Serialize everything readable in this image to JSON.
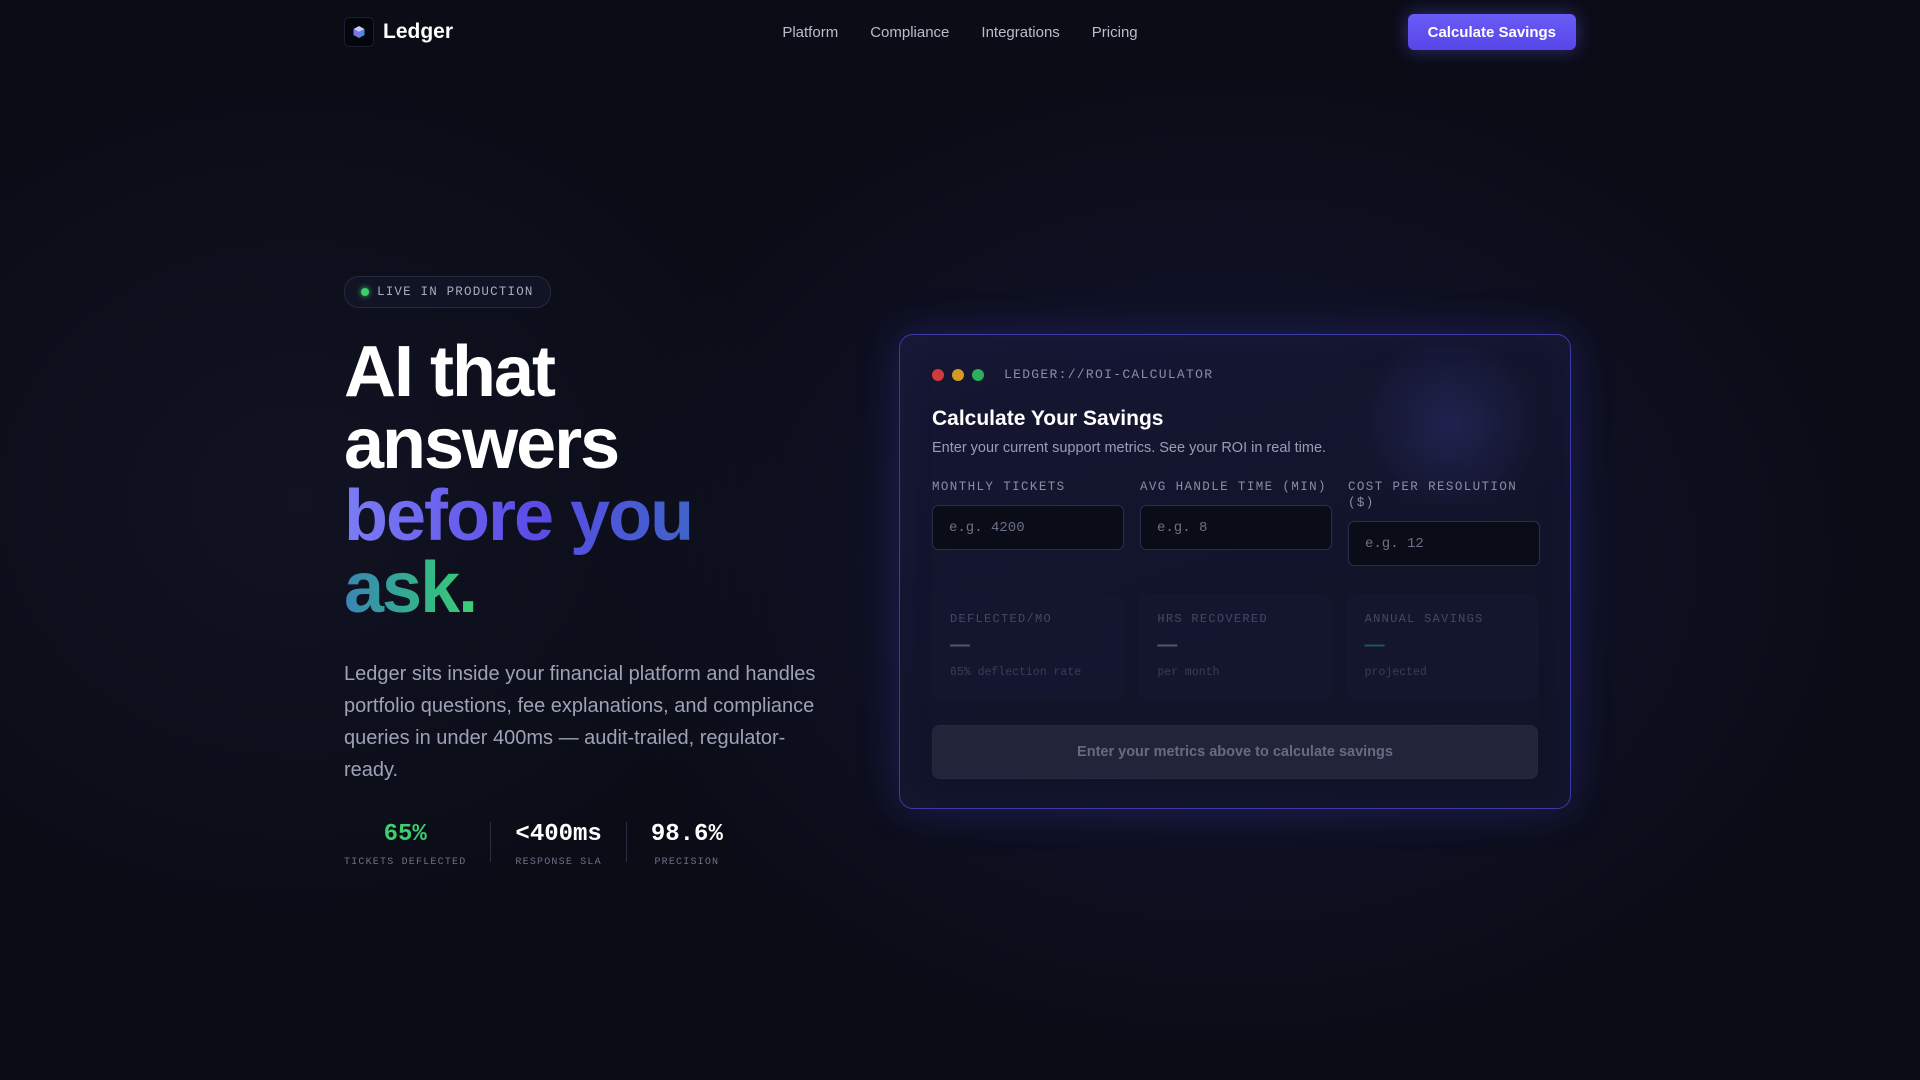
{
  "nav": {
    "brand": "Ledger",
    "links": [
      "Platform",
      "Compliance",
      "Integrations",
      "Pricing"
    ],
    "cta_label": "Calculate Savings"
  },
  "hero": {
    "badge": "LIVE IN PRODUCTION",
    "headline_lines": [
      "AI that",
      "answers",
      "before you",
      "ask."
    ],
    "description": "Ledger sits inside your financial platform and handles portfolio questions, fee explanations, and compliance queries in under 400ms — audit-trailed, regulator-ready.",
    "stats": [
      {
        "value": "65%",
        "label": "TICKETS DEFLECTED"
      },
      {
        "value": "<400ms",
        "label": "RESPONSE SLA"
      },
      {
        "value": "98.6%",
        "label": "PRECISION"
      }
    ]
  },
  "calculator": {
    "window_title": "LEDGER://ROI-CALCULATOR",
    "title": "Calculate Your Savings",
    "subtitle": "Enter your current support metrics. See your ROI in real time.",
    "fields": [
      {
        "label": "MONTHLY TICKETS",
        "placeholder": "e.g. 4200",
        "value": ""
      },
      {
        "label": "AVG HANDLE TIME (MIN)",
        "placeholder": "e.g. 8",
        "value": ""
      },
      {
        "label": "COST PER RESOLUTION ($)",
        "placeholder": "e.g. 12",
        "value": ""
      }
    ],
    "results": [
      {
        "label": "DEFLECTED/MO",
        "value": "—",
        "note": "65% deflection rate"
      },
      {
        "label": "HRS RECOVERED",
        "value": "—",
        "note": "per month"
      },
      {
        "label": "ANNUAL SAVINGS",
        "value": "—",
        "note": "projected"
      }
    ],
    "button_label": "Enter your metrics above to calculate savings"
  },
  "colors": {
    "background": "#0a0c16",
    "accent": "#5b4be6",
    "success": "#3ccf6e",
    "card_border": "#3b3aa6"
  },
  "icons": {
    "logo": "cube-logo-icon",
    "status": "status-dot-icon"
  }
}
